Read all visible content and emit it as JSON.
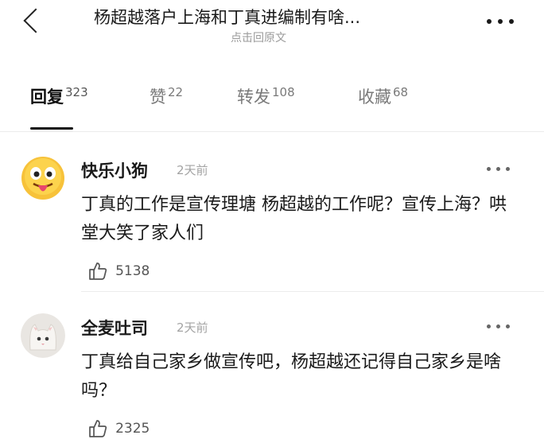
{
  "header": {
    "title": "杨超越落户上海和丁真进编制有啥...",
    "subtitle": "点击回原文"
  },
  "tabs": [
    {
      "label": "回复",
      "count": "323",
      "active": true
    },
    {
      "label": "赞",
      "count": "22",
      "active": false
    },
    {
      "label": "转发",
      "count": "108",
      "active": false
    },
    {
      "label": "收藏",
      "count": "68",
      "active": false
    }
  ],
  "comments": [
    {
      "username": "快乐小狗",
      "time": "2天前",
      "content": "丁真的工作是宣传理塘 杨超越的工作呢？宣传上海？哄堂大笑了家人们",
      "likes": "5138",
      "avatar_icon": "tongue-emoji-avatar"
    },
    {
      "username": "全麦吐司",
      "time": "2天前",
      "content": "丁真给自己家乡做宣传吧，杨超越还记得自己家乡是啥吗？",
      "likes": "2325",
      "avatar_icon": "cat-photo-avatar"
    }
  ],
  "colors": {
    "text_primary": "#1a1a1a",
    "text_secondary": "#9a9a9a",
    "divider": "#ececec"
  }
}
